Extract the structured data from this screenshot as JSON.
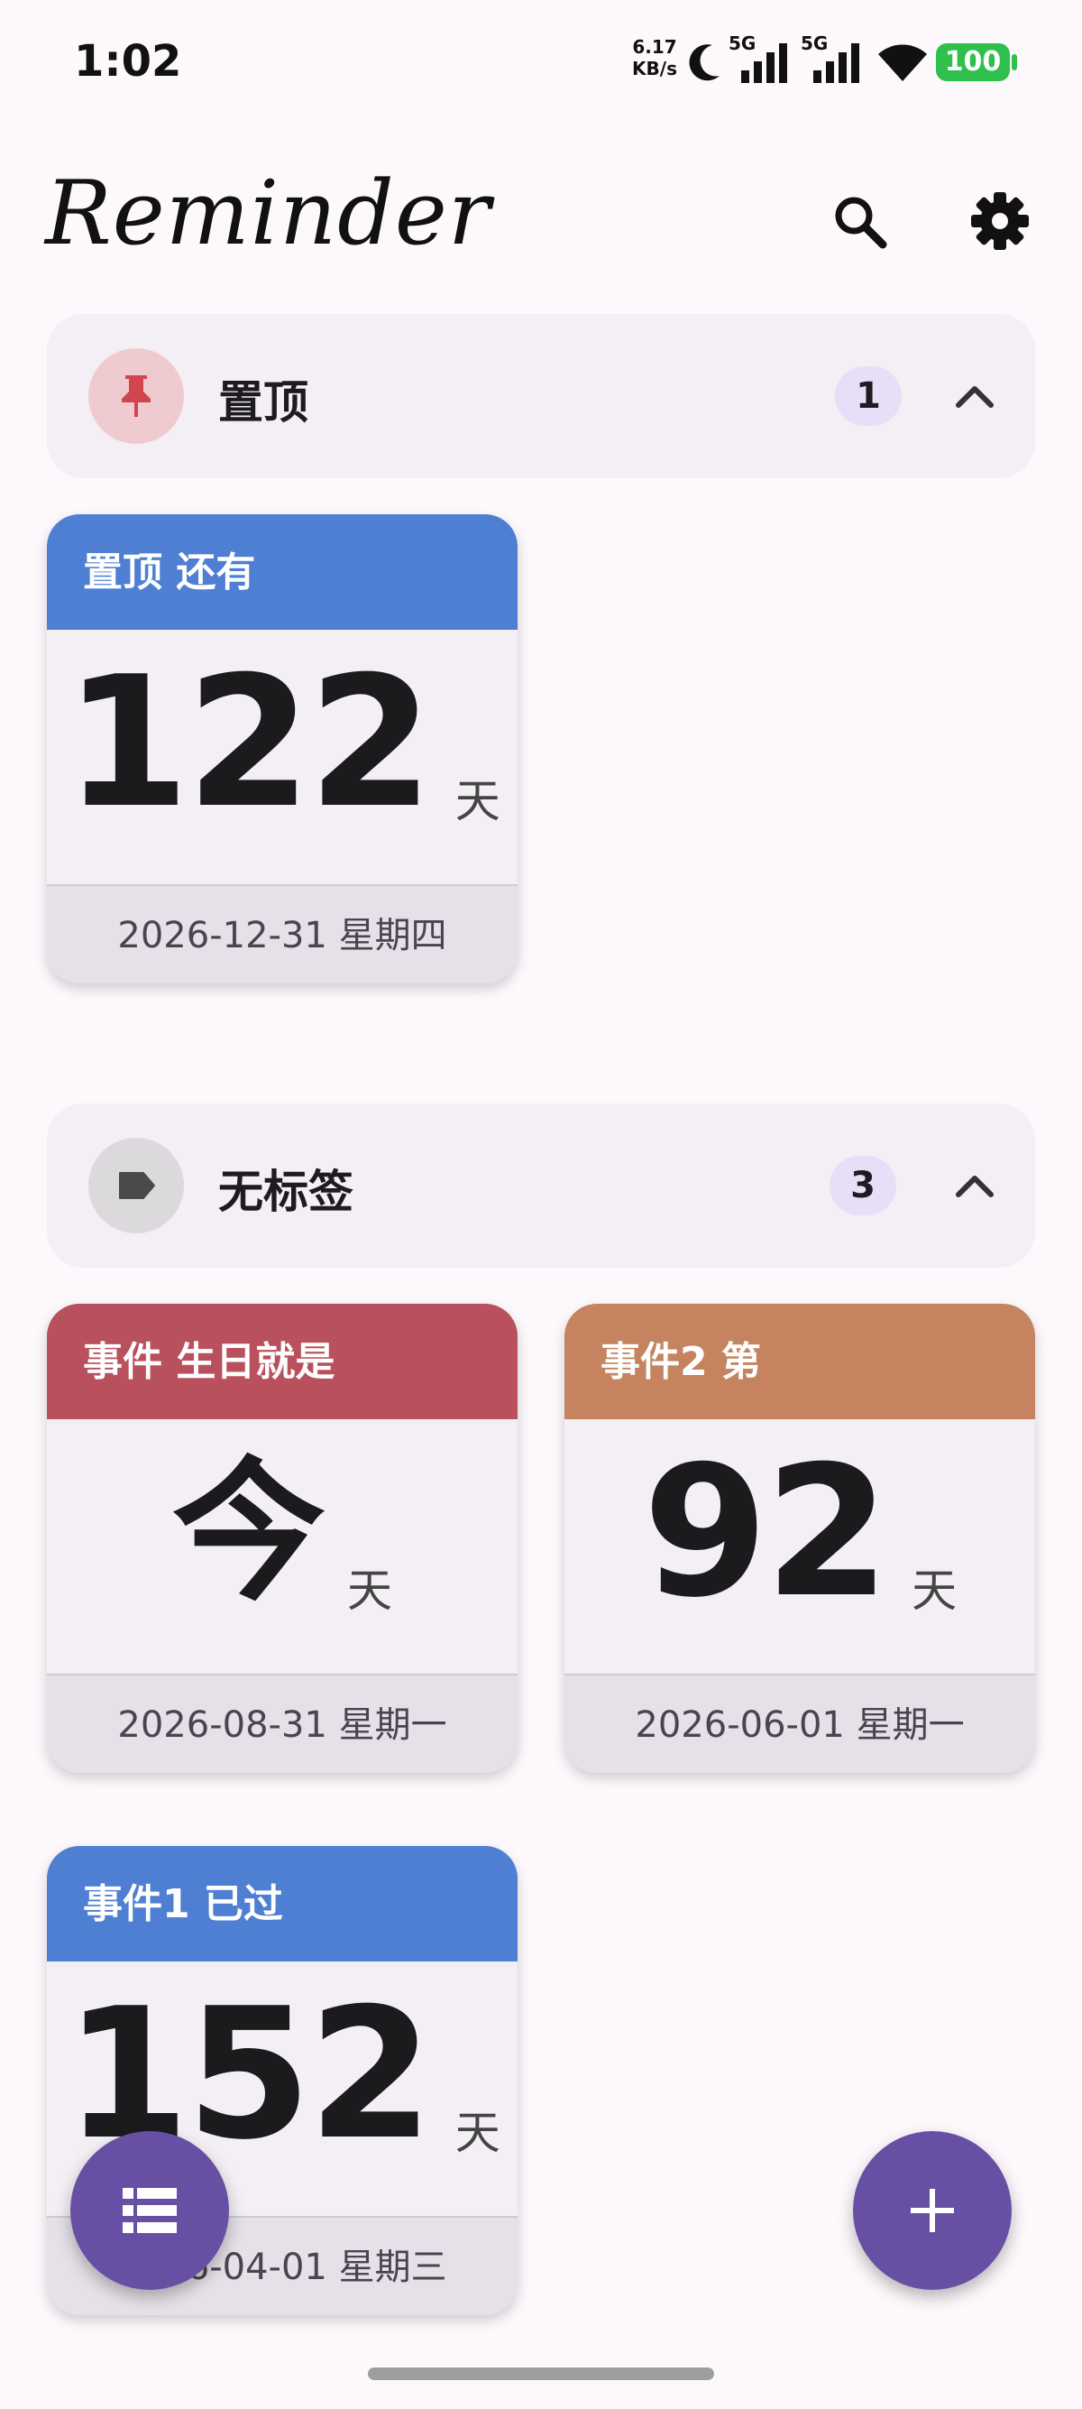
{
  "status_bar": {
    "time": "1:02",
    "net_speed_value": "6.17",
    "net_speed_unit": "KB/s",
    "sim1": "5G",
    "sim2": "5G",
    "battery": "100"
  },
  "app": {
    "title": "Reminder"
  },
  "sections": [
    {
      "label": "置顶",
      "count": "1",
      "icon": "pin-icon"
    },
    {
      "label": "无标签",
      "count": "3",
      "icon": "tag-icon"
    }
  ],
  "cards": [
    {
      "title": "置顶 还有",
      "number": "122",
      "unit": "天",
      "date": "2026-12-31 星期四",
      "color": "#4e7fd3"
    },
    {
      "title": "事件 生日就是",
      "number": "今",
      "unit": "天",
      "date": "2026-08-31 星期一",
      "color": "#b9505d"
    },
    {
      "title": "事件2 第",
      "number": "92",
      "unit": "天",
      "date": "2026-06-01 星期一",
      "color": "#c5845f"
    },
    {
      "title": "事件1 已过",
      "number": "152",
      "unit": "天",
      "date": "2026-04-01 星期三",
      "color": "#4e7fd3"
    }
  ],
  "colors": {
    "accent": "#6750a4",
    "background": "#fcf8fc"
  }
}
